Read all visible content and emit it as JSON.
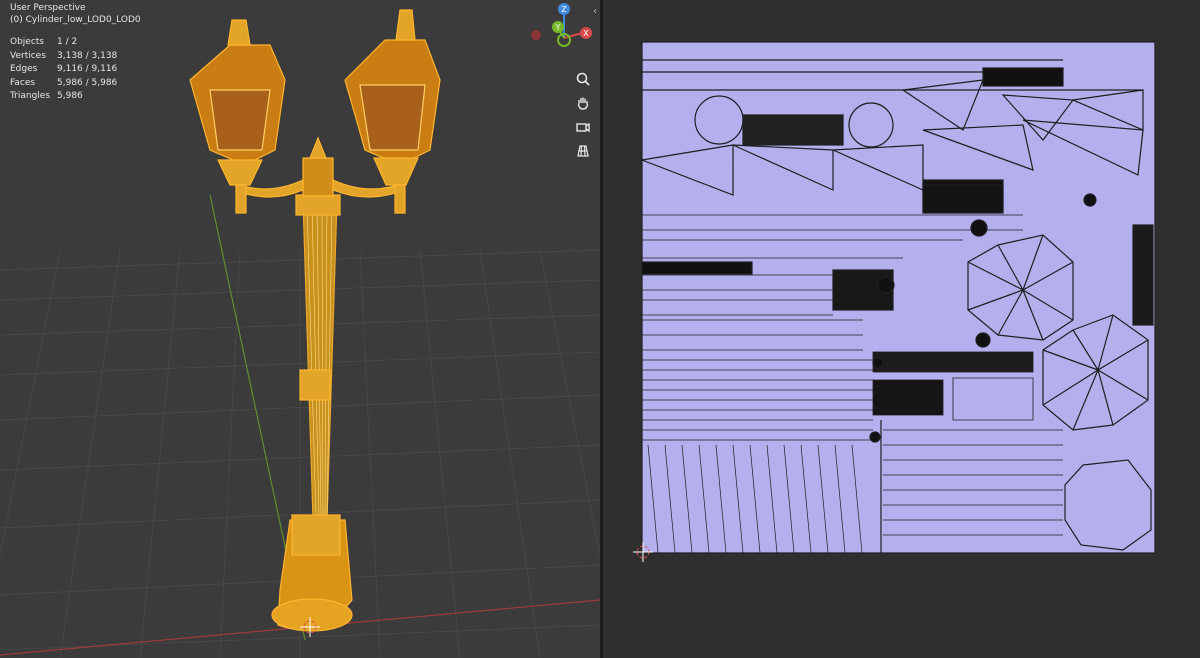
{
  "viewport": {
    "title": "User Perspective",
    "object_name": "(0) Cylinder_low_LOD0_LOD0",
    "stats": [
      {
        "label": "Objects",
        "value": "1 / 2"
      },
      {
        "label": "Vertices",
        "value": "3,138 / 3,138"
      },
      {
        "label": "Edges",
        "value": "9,116 / 9,116"
      },
      {
        "label": "Faces",
        "value": "5,986 / 5,986"
      },
      {
        "label": "Triangles",
        "value": "5,986"
      }
    ],
    "gizmo_axes": {
      "z": "Z",
      "y": "Y",
      "x": "X"
    },
    "nav_icons": [
      "zoom-icon",
      "hand-pan-icon",
      "camera-icon",
      "grid-view-icon"
    ]
  },
  "colors": {
    "viewport_bg": "#3b3b3b",
    "wire_selected": "#ff9e1f",
    "wire_light": "#ffd36a",
    "uv_fill": "#b7b3f0",
    "axis_x": "#d84a4a",
    "axis_y": "#76b82a",
    "axis_z": "#3f8ae0"
  }
}
